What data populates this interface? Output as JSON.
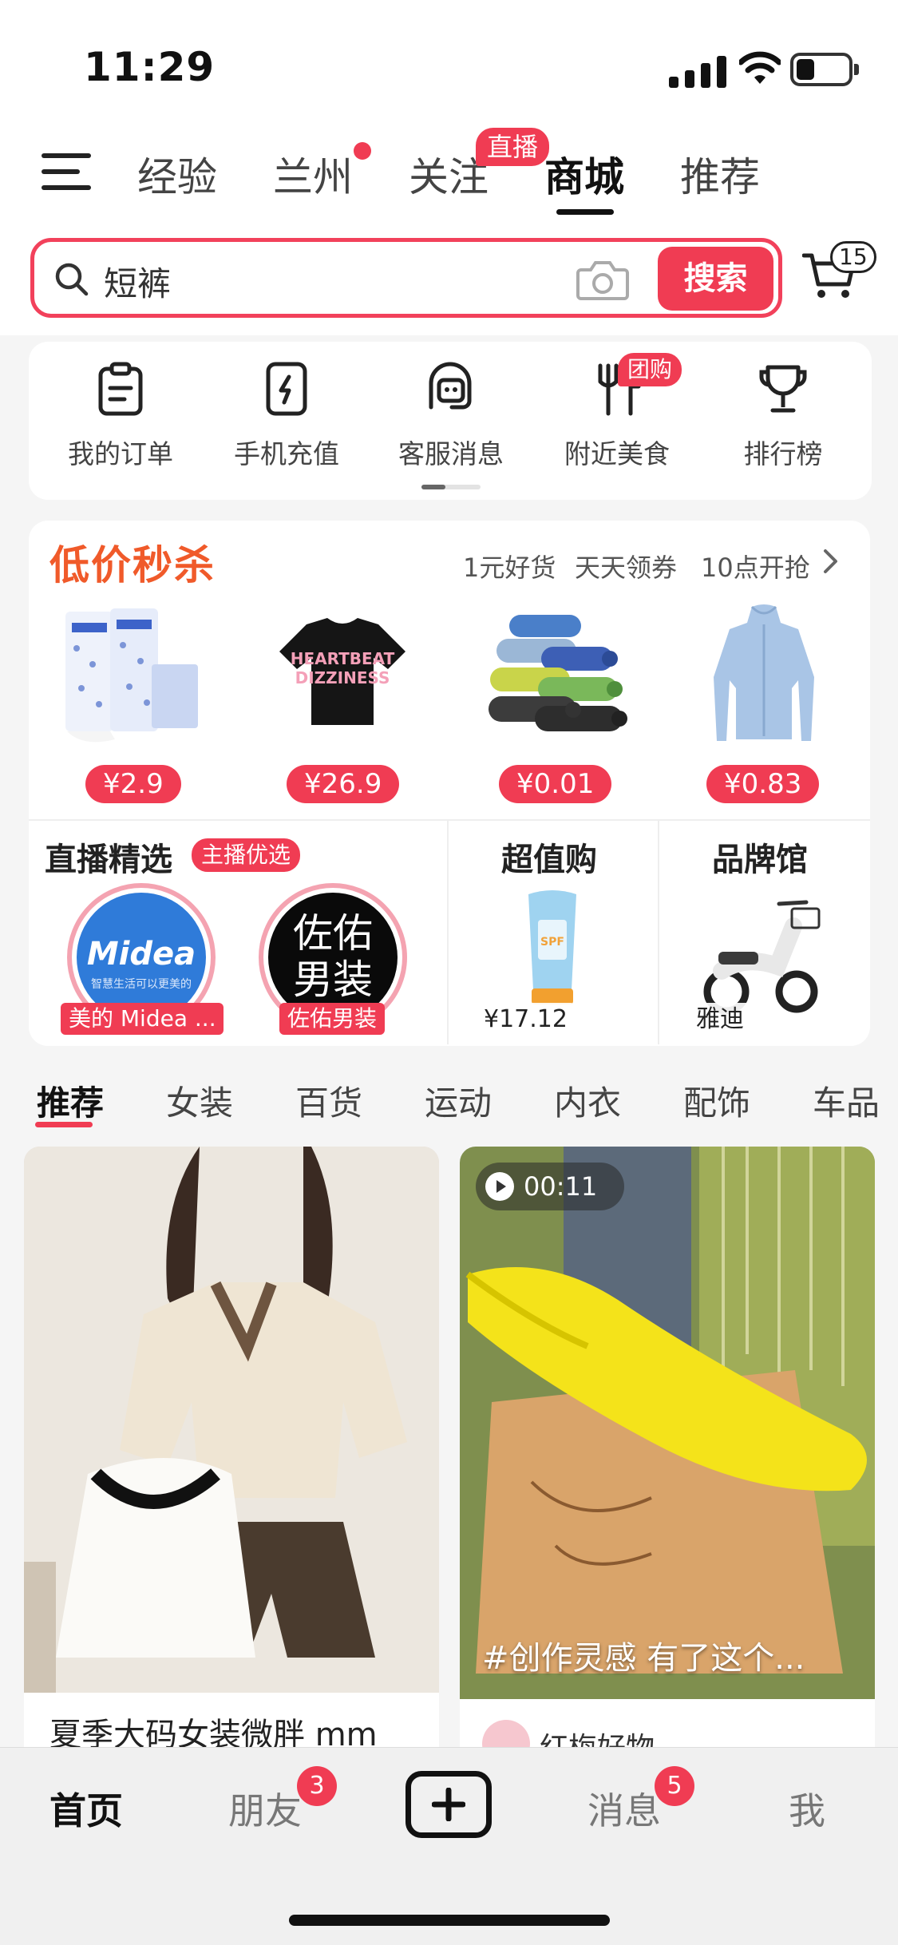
{
  "status_bar": {
    "time": "11:29"
  },
  "top_tabs": [
    {
      "label": "经验"
    },
    {
      "label": "兰州"
    },
    {
      "label": "关注",
      "badge": "直播"
    },
    {
      "label": "商城",
      "active": true
    },
    {
      "label": "推荐"
    }
  ],
  "search": {
    "query": "短裤",
    "button_label": "搜索",
    "cart_count": "15"
  },
  "quick_actions": [
    {
      "label": "我的订单",
      "icon": "clipboard-icon"
    },
    {
      "label": "手机充值",
      "icon": "phone-charge-icon"
    },
    {
      "label": "客服消息",
      "icon": "customer-service-icon"
    },
    {
      "label": "附近美食",
      "icon": "fork-knife-icon",
      "badge": "团购"
    },
    {
      "label": "排行榜",
      "icon": "trophy-icon"
    }
  ],
  "flash_sale": {
    "title": "低价秒杀",
    "links": [
      "1元好货",
      "天天领券",
      "10点开抢"
    ],
    "products": [
      {
        "name": "tissue-pack",
        "price": "¥2.9"
      },
      {
        "name": "black-tshirt",
        "price": "¥26.9"
      },
      {
        "name": "garbage-bags",
        "price": "¥0.01"
      },
      {
        "name": "sun-protection-jacket",
        "price": "¥0.83"
      }
    ]
  },
  "live_picks": {
    "title": "直播精选",
    "badge": "主播优选",
    "streams": [
      {
        "logo_text": "Midea",
        "logo_sub": "智慧生活可以更美的",
        "name": "美的 Midea ..."
      },
      {
        "logo_text_1": "佐佑",
        "logo_text_2": "男装",
        "name": "佐佑男装"
      }
    ]
  },
  "value_buy": {
    "title": "超值购",
    "price": "¥17.12"
  },
  "brand_hall": {
    "title": "品牌馆",
    "brand": "雅迪"
  },
  "category_tabs": [
    "推荐",
    "女装",
    "百货",
    "运动",
    "内衣",
    "配饰",
    "车品"
  ],
  "feed": [
    {
      "title": "夏季大码女装微胖 mm"
    },
    {
      "video_duration": "00:11",
      "caption": "#创作灵感 有了这个...",
      "author": "红梅好物"
    }
  ],
  "bottom_nav": {
    "home": "首页",
    "friends": "朋友",
    "friends_badge": "3",
    "messages": "消息",
    "messages_badge": "5",
    "me": "我"
  },
  "colors": {
    "accent": "#f03c53",
    "sale_title": "#f05a2a"
  }
}
